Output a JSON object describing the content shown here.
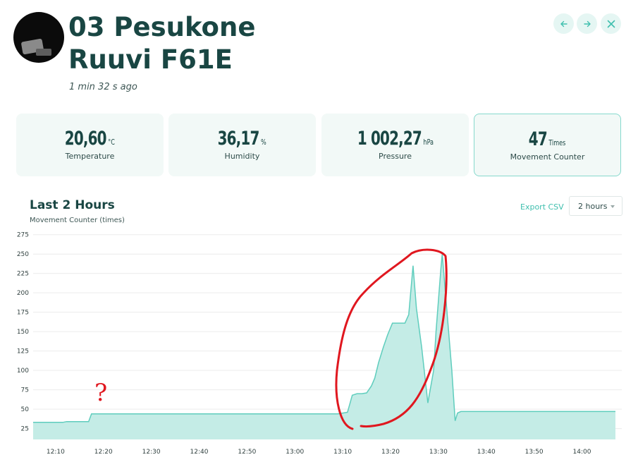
{
  "header": {
    "title_line1": "03 Pesukone",
    "title_line2": "Ruuvi F61E",
    "updated": "1 min 32 s ago"
  },
  "nav": {
    "prev_icon": "arrow-left-icon",
    "next_icon": "arrow-right-icon",
    "close_icon": "close-icon"
  },
  "cards": [
    {
      "value": "20,60",
      "unit": "°C",
      "label": "Temperature"
    },
    {
      "value": "36,17",
      "unit": "%",
      "label": "Humidity"
    },
    {
      "value": "1 002,27",
      "unit": "hPa",
      "label": "Pressure"
    },
    {
      "value": "47",
      "unit": "Times",
      "label": "Movement Counter"
    }
  ],
  "section": {
    "title": "Last 2 Hours",
    "subtitle": "Movement Counter (times)",
    "export_label": "Export CSV",
    "range_selected": "2 hours"
  },
  "annotation": {
    "mark": "?",
    "color": "#e0171f"
  },
  "colors": {
    "accent": "#3fbfae",
    "area_fill": "#c4ece6",
    "line": "#5fcdbd",
    "text": "#194643"
  },
  "chart_data": {
    "type": "area",
    "xlabel": "",
    "ylabel": "",
    "ylim": [
      11,
      282
    ],
    "yticks": [
      25,
      50,
      75,
      100,
      125,
      150,
      175,
      200,
      225,
      250,
      275
    ],
    "xticks": [
      "12:10",
      "12:20",
      "12:30",
      "12:40",
      "12:50",
      "13:00",
      "13:10",
      "13:20",
      "13:30",
      "13:40",
      "13:50",
      "14:00"
    ],
    "x_unit": "minutes from 12:00",
    "xlim": [
      5.3,
      127
    ],
    "grid": true,
    "series": [
      {
        "x": [
          5.3,
          11.5,
          12.3,
          16,
          16.9,
          17.5,
          18.5,
          68,
          69,
          70,
          71,
          72,
          73,
          74,
          75,
          76,
          76.7,
          77.5,
          78.5,
          79.4,
          80.4,
          81.2,
          81.9,
          83,
          83.8,
          84.7,
          85.4,
          86.5,
          87.8,
          89,
          89.5,
          90,
          90.5,
          90.8,
          92.8,
          93.5,
          94,
          94.7,
          127
        ],
        "y": [
          33,
          33,
          34,
          34,
          34,
          44,
          44,
          44,
          44,
          45,
          46,
          68,
          70,
          70,
          71,
          80,
          90,
          110,
          130,
          146,
          161,
          161,
          161,
          161,
          172,
          235,
          180,
          130,
          58,
          100,
          150,
          190,
          230,
          250,
          100,
          35,
          45,
          47,
          47
        ]
      }
    ]
  }
}
